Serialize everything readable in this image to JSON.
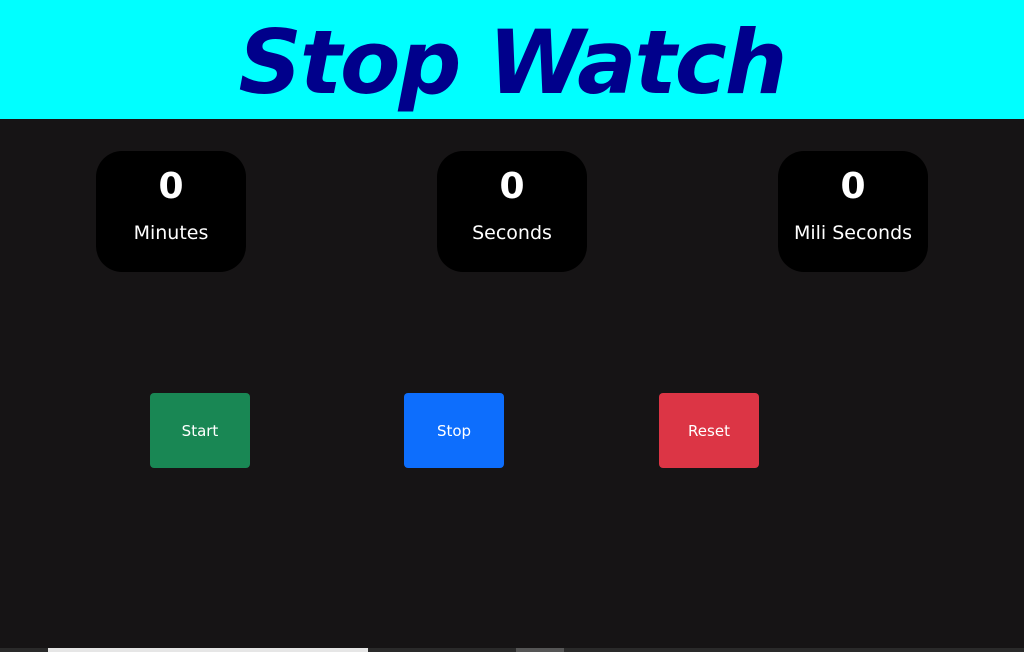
{
  "header": {
    "title": "Stop Watch",
    "background_color": "#00ffff",
    "title_color": "#00008b"
  },
  "counters": [
    {
      "value": "0",
      "label": "Minutes"
    },
    {
      "value": "0",
      "label": "Seconds"
    },
    {
      "value": "0",
      "label": "Mili Seconds"
    }
  ],
  "controls": {
    "start_label": "Start",
    "stop_label": "Stop",
    "reset_label": "Reset",
    "start_color": "#198754",
    "stop_color": "#0d6efd",
    "reset_color": "#dc3545"
  },
  "page": {
    "background_color": "#161415",
    "counter_background": "#000000"
  }
}
